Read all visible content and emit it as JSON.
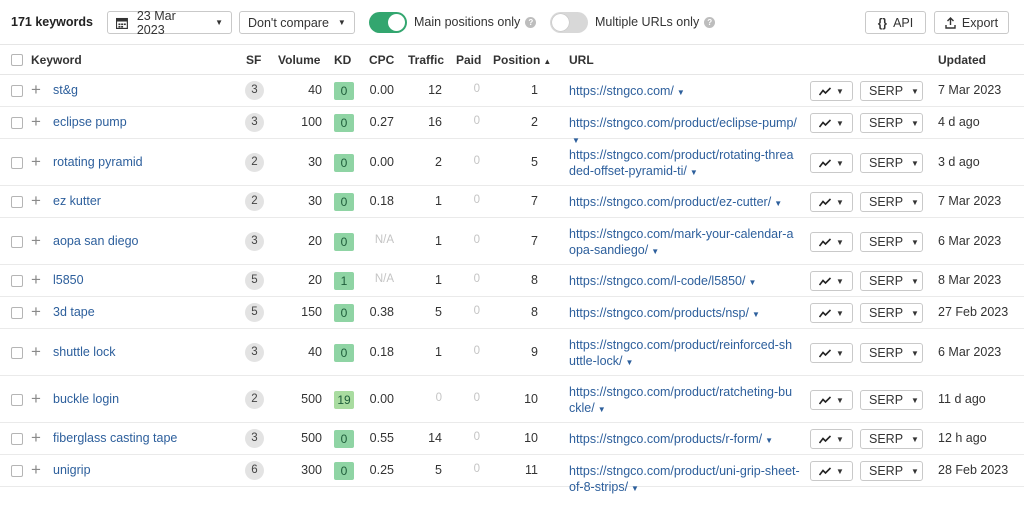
{
  "toolbar": {
    "keyword_count": "171 keywords",
    "date": "23 Mar 2023",
    "compare": "Don't compare",
    "main_positions_label": "Main positions only",
    "main_positions_on": true,
    "multiple_urls_label": "Multiple URLs only",
    "multiple_urls_on": false,
    "api_label": "API",
    "export_label": "Export"
  },
  "columns": {
    "keyword": "Keyword",
    "sf": "SF",
    "volume": "Volume",
    "kd": "KD",
    "cpc": "CPC",
    "traffic": "Traffic",
    "paid": "Paid",
    "position": "Position",
    "url": "URL",
    "updated": "Updated"
  },
  "kd_colors": {
    "low": "#8fd4a4",
    "mid": "#a9dca0"
  },
  "serp_label": "SERP",
  "rows": [
    {
      "keyword": "st&g",
      "sf": "3",
      "volume": "40",
      "kd": "0",
      "cpc": "0.00",
      "traffic": "12",
      "paid": "0",
      "position": "1",
      "url1": "https://stngco.com/",
      "url2": "",
      "updated": "7 Mar 2023"
    },
    {
      "keyword": "eclipse pump",
      "sf": "3",
      "volume": "100",
      "kd": "0",
      "cpc": "0.27",
      "traffic": "16",
      "paid": "0",
      "position": "2",
      "url1": "https://stngco.com/product/eclipse-pum",
      "url2": "p/",
      "updated": "4 d ago"
    },
    {
      "keyword": "rotating pyramid",
      "sf": "2",
      "volume": "30",
      "kd": "0",
      "cpc": "0.00",
      "traffic": "2",
      "paid": "0",
      "position": "5",
      "url1": "https://stngco.com/product/rotating-threa",
      "url2": "ded-offset-pyramid-ti/",
      "updated": "3 d ago"
    },
    {
      "keyword": "ez kutter",
      "sf": "2",
      "volume": "30",
      "kd": "0",
      "cpc": "0.18",
      "traffic": "1",
      "paid": "0",
      "position": "7",
      "url1": "https://stngco.com/product/ez-cutter/",
      "url2": "",
      "updated": "7 Mar 2023"
    },
    {
      "keyword": "aopa san diego",
      "sf": "3",
      "volume": "20",
      "kd": "0",
      "cpc": "N/A",
      "traffic": "1",
      "paid": "0",
      "position": "7",
      "url1": "https://stngco.com/mark-your-calendar-a",
      "url2": "opa-sandiego/",
      "updated": "6 Mar 2023"
    },
    {
      "keyword": "l5850",
      "sf": "5",
      "volume": "20",
      "kd": "1",
      "cpc": "N/A",
      "traffic": "1",
      "paid": "0",
      "position": "8",
      "url1": "https://stngco.com/l-code/l5850/",
      "url2": "",
      "updated": "8 Mar 2023"
    },
    {
      "keyword": "3d tape",
      "sf": "5",
      "volume": "150",
      "kd": "0",
      "cpc": "0.38",
      "traffic": "5",
      "paid": "0",
      "position": "8",
      "url1": "https://stngco.com/products/nsp/",
      "url2": "",
      "updated": "27 Feb 2023"
    },
    {
      "keyword": "shuttle lock",
      "sf": "3",
      "volume": "40",
      "kd": "0",
      "cpc": "0.18",
      "traffic": "1",
      "paid": "0",
      "position": "9",
      "url1": "https://stngco.com/product/reinforced-sh",
      "url2": "uttle-lock/",
      "updated": "6 Mar 2023"
    },
    {
      "keyword": "buckle login",
      "sf": "2",
      "volume": "500",
      "kd": "19",
      "cpc": "0.00",
      "traffic": "0",
      "paid": "0",
      "position": "10",
      "url1": "https://stngco.com/product/ratcheting-bu",
      "url2": "ckle/",
      "updated": "11 d ago"
    },
    {
      "keyword": "fiberglass casting tape",
      "sf": "3",
      "volume": "500",
      "kd": "0",
      "cpc": "0.55",
      "traffic": "14",
      "paid": "0",
      "position": "10",
      "url1": "https://stngco.com/products/r-form/",
      "url2": "",
      "updated": "12 h ago"
    },
    {
      "keyword": "unigrip",
      "sf": "6",
      "volume": "300",
      "kd": "0",
      "cpc": "0.25",
      "traffic": "5",
      "paid": "0",
      "position": "11",
      "url1": "https://stngco.com/product/uni-grip-sheet",
      "url2": "-of-8-strips/",
      "updated": "28 Feb 2023"
    }
  ]
}
